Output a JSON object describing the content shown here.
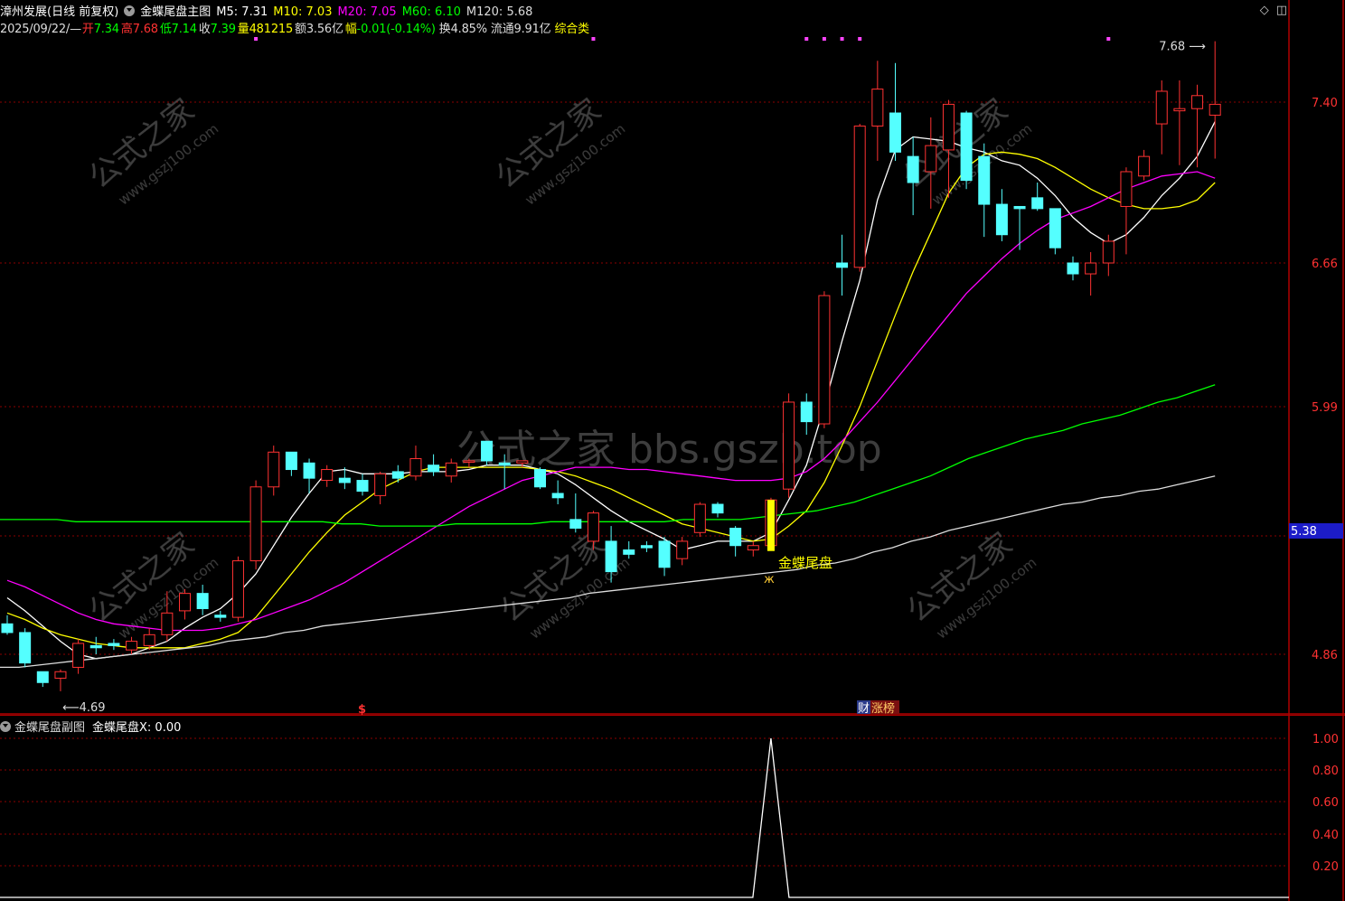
{
  "header": {
    "stock_title": "漳州发展(日线 前复权)",
    "main_chart_name": "金蝶尾盘主图",
    "ma": [
      {
        "label": "M5: 7.31",
        "color": "#ffffff"
      },
      {
        "label": "M10: 7.03",
        "color": "#ffff00"
      },
      {
        "label": "M20: 7.05",
        "color": "#ff00ff"
      },
      {
        "label": "M60: 6.10",
        "color": "#00ff00"
      },
      {
        "label": "M120: 5.68",
        "color": "#dddddd"
      }
    ],
    "quote": {
      "date": "2025/09/22/—",
      "open_label": "开",
      "open": "7.34",
      "high_label": "高",
      "high": "7.68",
      "low_label": "低",
      "low": "7.14",
      "close_label": "收",
      "close": "7.39",
      "vol_label": "量",
      "vol": "481215",
      "amt_label": "额",
      "amt": "3.56亿",
      "chg_label": "幅",
      "chg": "-0.01(-0.14%)",
      "turn_label": "换",
      "turn": "4.85%",
      "float_label": "流通",
      "float": "9.91亿",
      "sector": "综合类"
    },
    "icons": [
      "diamond-icon",
      "window-icon"
    ]
  },
  "watermark": {
    "center": "公式之家 bbs.gszb.top",
    "small_cn": "公式之家",
    "small_url": "www.gszj100.com"
  },
  "price_axis": {
    "ticks": [
      "7.40",
      "6.66",
      "5.99",
      "4.86"
    ],
    "current_label": "5.38"
  },
  "annotations": {
    "high_label": "7.68",
    "low_label": "4.69",
    "signal_label": "金蝶尾盘",
    "money_marker": "$",
    "badge_left": "财",
    "badge_right": "涨榜"
  },
  "colors": {
    "up": "#ff3232",
    "down": "#54ffff",
    "ma5": "#ffffff",
    "ma10": "#ffff00",
    "ma20": "#ff00ff",
    "ma60": "#00ff00",
    "ma120": "#dddddd",
    "grid": "#8b0000",
    "signal": "#ffff00"
  },
  "sub_chart": {
    "name": "金蝶尾盘副图",
    "series_label": "金蝶尾盘X: 0.00",
    "ticks": [
      "1.00",
      "0.80",
      "0.60",
      "0.40",
      "0.20"
    ]
  },
  "chart_data": [
    {
      "type": "candlestick",
      "title": "漳州发展(日线 前复权)",
      "ylim": [
        4.55,
        7.9
      ],
      "candles": [
        {
          "o": 5.0,
          "h": 5.04,
          "l": 4.95,
          "c": 4.96
        },
        {
          "o": 4.96,
          "h": 4.98,
          "l": 4.8,
          "c": 4.82
        },
        {
          "o": 4.78,
          "h": 4.78,
          "l": 4.71,
          "c": 4.73
        },
        {
          "o": 4.75,
          "h": 4.79,
          "l": 4.69,
          "c": 4.78
        },
        {
          "o": 4.8,
          "h": 4.93,
          "l": 4.77,
          "c": 4.91
        },
        {
          "o": 4.9,
          "h": 4.94,
          "l": 4.86,
          "c": 4.89
        },
        {
          "o": 4.91,
          "h": 4.93,
          "l": 4.88,
          "c": 4.9
        },
        {
          "o": 4.88,
          "h": 4.94,
          "l": 4.86,
          "c": 4.92
        },
        {
          "o": 4.9,
          "h": 4.98,
          "l": 4.88,
          "c": 4.95
        },
        {
          "o": 4.95,
          "h": 5.15,
          "l": 4.92,
          "c": 5.05
        },
        {
          "o": 5.06,
          "h": 5.16,
          "l": 5.02,
          "c": 5.14
        },
        {
          "o": 5.14,
          "h": 5.18,
          "l": 5.04,
          "c": 5.07
        },
        {
          "o": 5.04,
          "h": 5.06,
          "l": 5.01,
          "c": 5.03
        },
        {
          "o": 5.03,
          "h": 5.31,
          "l": 5.01,
          "c": 5.29
        },
        {
          "o": 5.29,
          "h": 5.66,
          "l": 5.25,
          "c": 5.63
        },
        {
          "o": 5.63,
          "h": 5.82,
          "l": 5.59,
          "c": 5.79
        },
        {
          "o": 5.79,
          "h": 5.79,
          "l": 5.68,
          "c": 5.71
        },
        {
          "o": 5.74,
          "h": 5.76,
          "l": 5.6,
          "c": 5.67
        },
        {
          "o": 5.66,
          "h": 5.73,
          "l": 5.63,
          "c": 5.71
        },
        {
          "o": 5.67,
          "h": 5.72,
          "l": 5.62,
          "c": 5.65
        },
        {
          "o": 5.66,
          "h": 5.69,
          "l": 5.59,
          "c": 5.61
        },
        {
          "o": 5.59,
          "h": 5.7,
          "l": 5.55,
          "c": 5.69
        },
        {
          "o": 5.7,
          "h": 5.73,
          "l": 5.65,
          "c": 5.67
        },
        {
          "o": 5.68,
          "h": 5.82,
          "l": 5.66,
          "c": 5.76
        },
        {
          "o": 5.73,
          "h": 5.78,
          "l": 5.68,
          "c": 5.7
        },
        {
          "o": 5.68,
          "h": 5.76,
          "l": 5.65,
          "c": 5.74
        },
        {
          "o": 5.75,
          "h": 5.76,
          "l": 5.72,
          "c": 5.75
        },
        {
          "o": 5.84,
          "h": 5.84,
          "l": 5.73,
          "c": 5.75
        },
        {
          "o": 5.74,
          "h": 5.78,
          "l": 5.62,
          "c": 5.73
        },
        {
          "o": 5.74,
          "h": 5.75,
          "l": 5.72,
          "c": 5.75
        },
        {
          "o": 5.71,
          "h": 5.72,
          "l": 5.62,
          "c": 5.63
        },
        {
          "o": 5.6,
          "h": 5.66,
          "l": 5.55,
          "c": 5.58
        },
        {
          "o": 5.48,
          "h": 5.6,
          "l": 5.42,
          "c": 5.44
        },
        {
          "o": 5.38,
          "h": 5.52,
          "l": 5.34,
          "c": 5.51
        },
        {
          "o": 5.38,
          "h": 5.45,
          "l": 5.19,
          "c": 5.24
        },
        {
          "o": 5.34,
          "h": 5.38,
          "l": 5.3,
          "c": 5.32
        },
        {
          "o": 5.36,
          "h": 5.38,
          "l": 5.33,
          "c": 5.35
        },
        {
          "o": 5.38,
          "h": 5.4,
          "l": 5.22,
          "c": 5.26
        },
        {
          "o": 5.3,
          "h": 5.4,
          "l": 5.27,
          "c": 5.38
        },
        {
          "o": 5.42,
          "h": 5.56,
          "l": 5.4,
          "c": 5.55
        },
        {
          "o": 5.55,
          "h": 5.56,
          "l": 5.49,
          "c": 5.51
        },
        {
          "o": 5.44,
          "h": 5.45,
          "l": 5.31,
          "c": 5.36
        },
        {
          "o": 5.34,
          "h": 5.38,
          "l": 5.31,
          "c": 5.36
        },
        {
          "o": 5.36,
          "h": 5.58,
          "l": 5.35,
          "c": 5.57
        },
        {
          "o": 5.62,
          "h": 6.06,
          "l": 5.58,
          "c": 6.02
        },
        {
          "o": 6.02,
          "h": 6.06,
          "l": 5.87,
          "c": 5.93
        },
        {
          "o": 5.92,
          "h": 6.53,
          "l": 5.9,
          "c": 6.51
        },
        {
          "o": 6.66,
          "h": 6.79,
          "l": 6.51,
          "c": 6.64
        },
        {
          "o": 6.64,
          "h": 7.3,
          "l": 6.62,
          "c": 7.29
        },
        {
          "o": 7.29,
          "h": 7.59,
          "l": 7.13,
          "c": 7.46
        },
        {
          "o": 7.35,
          "h": 7.58,
          "l": 7.13,
          "c": 7.17
        },
        {
          "o": 7.15,
          "h": 7.24,
          "l": 6.88,
          "c": 7.03
        },
        {
          "o": 7.08,
          "h": 7.33,
          "l": 6.91,
          "c": 7.2
        },
        {
          "o": 7.18,
          "h": 7.41,
          "l": 6.96,
          "c": 7.39
        },
        {
          "o": 7.35,
          "h": 7.36,
          "l": 7.0,
          "c": 7.04
        },
        {
          "o": 7.15,
          "h": 7.21,
          "l": 6.78,
          "c": 6.93
        },
        {
          "o": 6.93,
          "h": 7.0,
          "l": 6.76,
          "c": 6.79
        },
        {
          "o": 6.92,
          "h": 6.92,
          "l": 6.72,
          "c": 6.91
        },
        {
          "o": 6.96,
          "h": 7.03,
          "l": 6.9,
          "c": 6.91
        },
        {
          "o": 6.91,
          "h": 6.91,
          "l": 6.7,
          "c": 6.73
        },
        {
          "o": 6.66,
          "h": 6.69,
          "l": 6.58,
          "c": 6.61
        },
        {
          "o": 6.61,
          "h": 6.71,
          "l": 6.51,
          "c": 6.66
        },
        {
          "o": 6.66,
          "h": 6.79,
          "l": 6.6,
          "c": 6.76
        },
        {
          "o": 6.92,
          "h": 7.1,
          "l": 6.7,
          "c": 7.08
        },
        {
          "o": 7.06,
          "h": 7.18,
          "l": 7.04,
          "c": 7.15
        },
        {
          "o": 7.3,
          "h": 7.5,
          "l": 7.16,
          "c": 7.45
        },
        {
          "o": 7.36,
          "h": 7.5,
          "l": 7.11,
          "c": 7.37
        },
        {
          "o": 7.37,
          "h": 7.48,
          "l": 7.1,
          "c": 7.43
        },
        {
          "o": 7.34,
          "h": 7.68,
          "l": 7.14,
          "c": 7.39
        }
      ],
      "ma_lines": {
        "M5": [
          5.12,
          5.06,
          4.99,
          4.92,
          4.86,
          4.84,
          4.85,
          4.86,
          4.89,
          4.92,
          4.98,
          5.03,
          5.07,
          5.14,
          5.23,
          5.36,
          5.49,
          5.6,
          5.7,
          5.71,
          5.69,
          5.69,
          5.69,
          5.7,
          5.7,
          5.7,
          5.71,
          5.73,
          5.73,
          5.73,
          5.71,
          5.69,
          5.64,
          5.58,
          5.52,
          5.47,
          5.43,
          5.39,
          5.34,
          5.36,
          5.38,
          5.38,
          5.38,
          5.42,
          5.57,
          5.73,
          6.0,
          6.3,
          6.58,
          6.95,
          7.18,
          7.24,
          7.23,
          7.22,
          7.19,
          7.17,
          7.13,
          7.11,
          7.05,
          6.97,
          6.87,
          6.8,
          6.75,
          6.79,
          6.87,
          6.97,
          7.05,
          7.15,
          7.31
        ],
        "M10": [
          5.05,
          5.02,
          4.98,
          4.95,
          4.93,
          4.91,
          4.9,
          4.89,
          4.89,
          4.89,
          4.89,
          4.91,
          4.93,
          4.96,
          5.03,
          5.13,
          5.23,
          5.33,
          5.42,
          5.5,
          5.56,
          5.62,
          5.66,
          5.7,
          5.72,
          5.72,
          5.72,
          5.72,
          5.72,
          5.72,
          5.71,
          5.7,
          5.68,
          5.65,
          5.62,
          5.58,
          5.54,
          5.5,
          5.46,
          5.44,
          5.42,
          5.4,
          5.38,
          5.39,
          5.45,
          5.52,
          5.65,
          5.82,
          6.0,
          6.21,
          6.42,
          6.62,
          6.8,
          6.98,
          7.1,
          7.16,
          7.17,
          7.16,
          7.14,
          7.1,
          7.05,
          7.0,
          6.96,
          6.93,
          6.91,
          6.91,
          6.92,
          6.95,
          7.03
        ],
        "M20": [
          5.2,
          5.17,
          5.13,
          5.09,
          5.05,
          5.02,
          5.0,
          4.99,
          4.98,
          4.97,
          4.97,
          4.97,
          4.98,
          5.0,
          5.02,
          5.05,
          5.08,
          5.11,
          5.15,
          5.19,
          5.24,
          5.29,
          5.34,
          5.39,
          5.44,
          5.49,
          5.54,
          5.58,
          5.62,
          5.66,
          5.68,
          5.7,
          5.72,
          5.72,
          5.72,
          5.71,
          5.71,
          5.7,
          5.69,
          5.68,
          5.67,
          5.66,
          5.66,
          5.66,
          5.67,
          5.7,
          5.76,
          5.84,
          5.93,
          6.02,
          6.12,
          6.22,
          6.32,
          6.42,
          6.52,
          6.6,
          6.68,
          6.75,
          6.81,
          6.86,
          6.89,
          6.92,
          6.96,
          7.0,
          7.03,
          7.06,
          7.07,
          7.08,
          7.05
        ],
        "M60": [
          5.48,
          5.48,
          5.48,
          5.48,
          5.47,
          5.47,
          5.47,
          5.47,
          5.47,
          5.47,
          5.47,
          5.47,
          5.47,
          5.47,
          5.47,
          5.47,
          5.47,
          5.47,
          5.46,
          5.46,
          5.45,
          5.45,
          5.45,
          5.45,
          5.46,
          5.46,
          5.46,
          5.46,
          5.46,
          5.47,
          5.47,
          5.47,
          5.47,
          5.47,
          5.47,
          5.47,
          5.48,
          5.48,
          5.48,
          5.48,
          5.49,
          5.5,
          5.51,
          5.52,
          5.54,
          5.56,
          5.59,
          5.62,
          5.65,
          5.68,
          5.72,
          5.76,
          5.79,
          5.82,
          5.85,
          5.87,
          5.89,
          5.92,
          5.94,
          5.96,
          5.99,
          6.02,
          6.04,
          6.07,
          6.1
        ],
        "M120": [
          4.8,
          4.8,
          4.81,
          4.82,
          4.83,
          4.84,
          4.85,
          4.86,
          4.87,
          4.88,
          4.89,
          4.9,
          4.92,
          4.93,
          4.94,
          4.96,
          4.97,
          4.99,
          5.0,
          5.01,
          5.02,
          5.03,
          5.04,
          5.05,
          5.06,
          5.07,
          5.08,
          5.09,
          5.1,
          5.11,
          5.12,
          5.14,
          5.15,
          5.16,
          5.17,
          5.18,
          5.19,
          5.2,
          5.21,
          5.22,
          5.23,
          5.24,
          5.25,
          5.27,
          5.28,
          5.3,
          5.33,
          5.35,
          5.38,
          5.4,
          5.43,
          5.45,
          5.47,
          5.49,
          5.51,
          5.53,
          5.55,
          5.56,
          5.58,
          5.59,
          5.61,
          5.62,
          5.64,
          5.66,
          5.68
        ]
      },
      "signal_index": 43
    },
    {
      "type": "line",
      "title": "金蝶尾盘副图",
      "ylim": [
        0,
        1
      ],
      "series": [
        {
          "name": "金蝶尾盘X",
          "peak_index": 43,
          "values": [
            0,
            1,
            0
          ]
        }
      ]
    }
  ]
}
